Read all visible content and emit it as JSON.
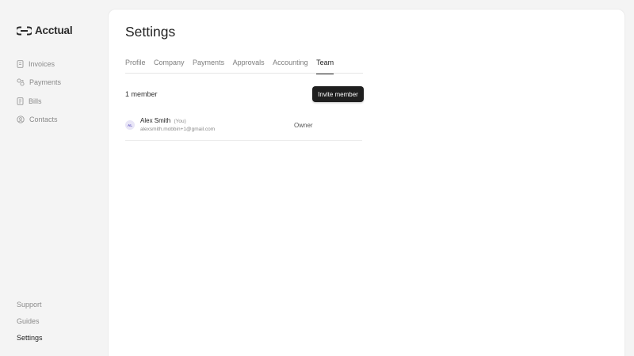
{
  "brand": {
    "name": "Acctual"
  },
  "sidebar": {
    "items": [
      {
        "label": "Invoices",
        "icon": "invoice-icon"
      },
      {
        "label": "Payments",
        "icon": "payments-icon"
      },
      {
        "label": "Bills",
        "icon": "bills-icon"
      },
      {
        "label": "Contacts",
        "icon": "contacts-icon"
      }
    ],
    "footer": [
      {
        "label": "Support"
      },
      {
        "label": "Guides"
      },
      {
        "label": "Settings"
      }
    ]
  },
  "page": {
    "title": "Settings"
  },
  "tabs": [
    {
      "label": "Profile"
    },
    {
      "label": "Company"
    },
    {
      "label": "Payments"
    },
    {
      "label": "Approvals"
    },
    {
      "label": "Accounting"
    },
    {
      "label": "Team"
    }
  ],
  "team": {
    "member_count": "1 member",
    "invite_label": "Invite member",
    "members": [
      {
        "initials": "AL",
        "name": "Alex Smith",
        "you_tag": "(You)",
        "email": "alexsmith.mobbin+1@gmail.com",
        "role": "Owner"
      }
    ]
  },
  "colors": {
    "background": "#f4f4f4",
    "panel": "#ffffff",
    "primary_button": "#1f1f1f",
    "muted_text": "#8a8a8a",
    "avatar_bg": "#e9e6f7"
  }
}
